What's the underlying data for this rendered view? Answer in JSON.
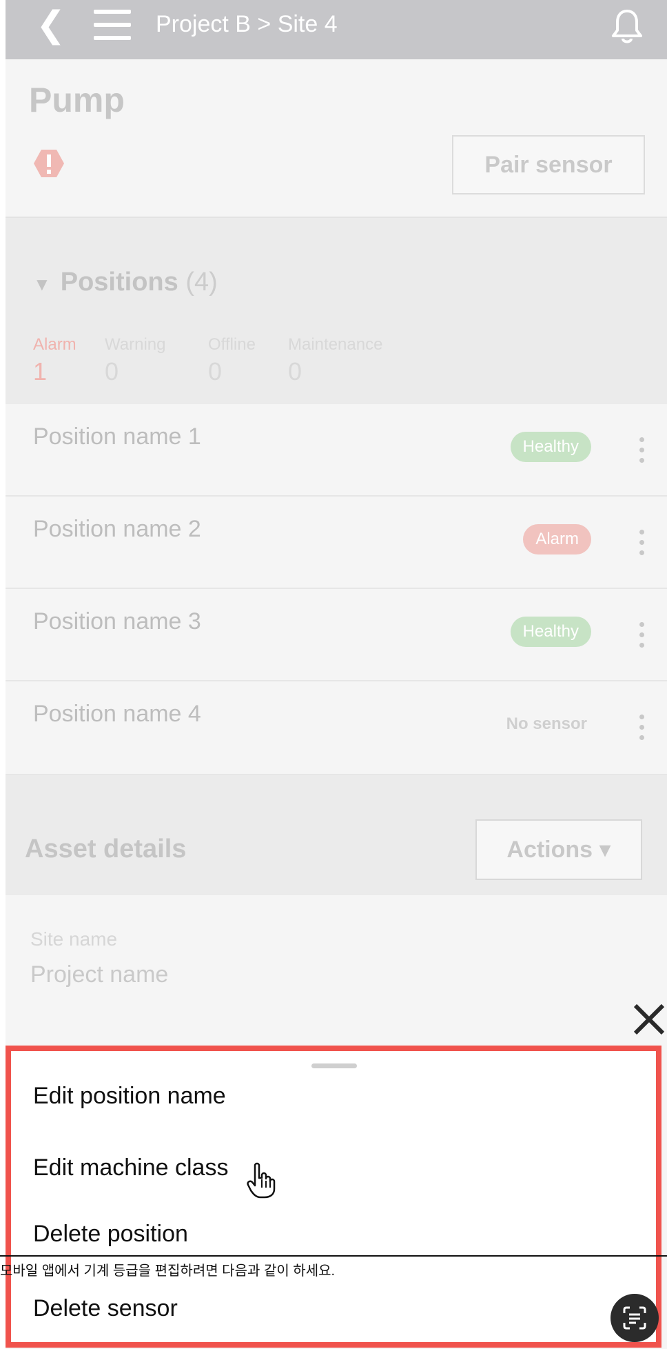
{
  "header": {
    "breadcrumb": "Project B > Site 4"
  },
  "asset": {
    "title": "Pump",
    "pair_sensor_label": "Pair sensor"
  },
  "positions": {
    "title": "Positions",
    "count": "(4)",
    "stats": [
      {
        "label": "Alarm",
        "value": "1"
      },
      {
        "label": "Warning",
        "value": "0"
      },
      {
        "label": "Offline",
        "value": "0"
      },
      {
        "label": "Maintenance",
        "value": "0"
      }
    ],
    "rows": [
      {
        "name": "Position name 1",
        "status": "Healthy"
      },
      {
        "name": "Position name 2",
        "status": "Alarm"
      },
      {
        "name": "Position name 3",
        "status": "Healthy"
      },
      {
        "name": "Position name 4",
        "status": "No sensor"
      }
    ]
  },
  "details": {
    "title": "Asset details",
    "actions_label": "Actions ▾",
    "site_label": "Site name",
    "site_value": "Project name"
  },
  "sheet": {
    "items": [
      "Edit position name",
      "Edit machine class",
      "Delete position",
      "Delete sensor"
    ]
  },
  "caption": "모바일 앱에서 기계 등급을 편집하려면 다음과 같이 하세요.",
  "colors": {
    "highlight_border": "#f0534d",
    "healthy": "#c7e3c5",
    "alarm": "#f1c3bf",
    "header": "#c6c6c9"
  },
  "icons": [
    "back-icon",
    "menu-icon",
    "bell-icon",
    "alert-icon",
    "kebab-icon",
    "close-icon",
    "cursor-icon",
    "scan-text-icon"
  ]
}
